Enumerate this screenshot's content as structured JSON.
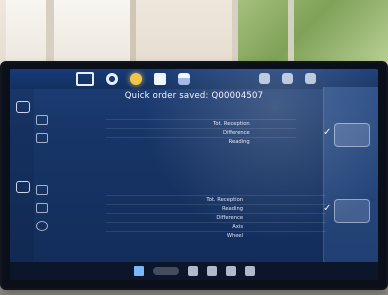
{
  "app": {
    "title": "Quick order saved: Q00004507"
  },
  "toolbar": {
    "icons": [
      {
        "name": "play-icon"
      },
      {
        "name": "gear-icon"
      },
      {
        "name": "sun-icon"
      },
      {
        "name": "document-icon"
      },
      {
        "name": "print-icon"
      }
    ],
    "right_icons": [
      {
        "name": "window-icon"
      },
      {
        "name": "layout-icon"
      },
      {
        "name": "minimize-icon"
      }
    ]
  },
  "table1": {
    "columns": [
      "",
      "",
      "",
      ""
    ],
    "rows": [
      {
        "label": "Tot. Reception",
        "values": [
          "",
          "",
          ""
        ]
      },
      {
        "label": "Difference",
        "values": [
          "",
          "",
          ""
        ]
      },
      {
        "label": "Reading",
        "values": [
          "",
          "",
          ""
        ]
      }
    ]
  },
  "table2": {
    "group_headers": [
      "",
      ""
    ],
    "columns": [
      "",
      "",
      "",
      "",
      "",
      ""
    ],
    "rows": [
      {
        "label": "Tot. Reception",
        "values": [
          "",
          "",
          "",
          "",
          "",
          ""
        ]
      },
      {
        "label": "Reading",
        "values": [
          "",
          "",
          "",
          "",
          "",
          ""
        ]
      },
      {
        "label": "Difference",
        "values": [
          "",
          "",
          "",
          "",
          "",
          ""
        ]
      },
      {
        "label": "Axis",
        "values": [
          "",
          "",
          "",
          "",
          "",
          ""
        ]
      },
      {
        "label": "Wheel",
        "values": [
          "",
          "",
          "",
          "",
          "",
          ""
        ]
      }
    ]
  },
  "taskbar": {
    "tray_line1": "",
    "tray_line2": ""
  },
  "colors": {
    "screen_bg": "#173567",
    "sidebar_bg": "#2a4d86",
    "toolbar_bg": "#173b7a"
  }
}
